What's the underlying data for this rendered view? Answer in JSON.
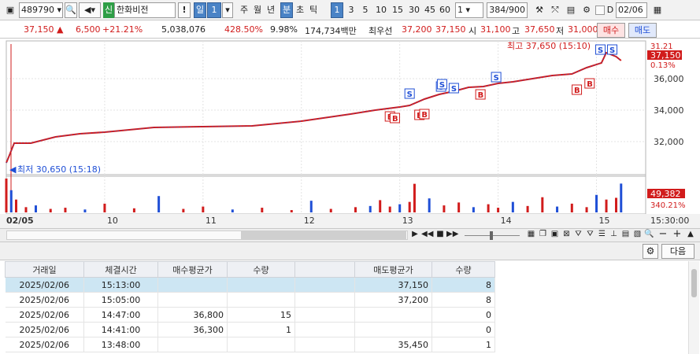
{
  "toolbar": {
    "code": "489790",
    "stock_name": "한화비전",
    "credit_badge": "신",
    "excl": "!",
    "period_day": "일",
    "period_num": "1",
    "periods": [
      "주",
      "월",
      "년"
    ],
    "period_min": "분",
    "period_sec": "초",
    "period_tick": "틱",
    "intervals": [
      "1",
      "3",
      "5",
      "10",
      "15",
      "30",
      "45",
      "60"
    ],
    "count_select": "1",
    "page_count": "384",
    "page_total": "/900",
    "date_prefix": "D",
    "date": "02/06"
  },
  "quote": {
    "price": "37,150",
    "arrow": "▲",
    "change": "6,500",
    "change_pct": "+21.21%",
    "volume": "5,038,076",
    "vol_ratio": "428.50%",
    "turnover": "9.98%",
    "amount": "174,734백만",
    "best_label": "최우선",
    "best_ask": "37,200",
    "best_bid": "37,150",
    "open_label": "시",
    "open": "31,100",
    "high_label": "고",
    "high": "37,650",
    "low_label": "저",
    "low": "31,000",
    "buy_label": "매수",
    "sell_label": "매도"
  },
  "chart_data": {
    "type": "line",
    "title": "",
    "xlabel": "",
    "ylabel": "",
    "price_ylim": [
      30000,
      38200
    ],
    "y_ticks": [
      "36,000",
      "34,000",
      "32,000"
    ],
    "y_tick_values": [
      36000,
      34000,
      32000
    ],
    "x_ticks": [
      "02/05",
      "10",
      "11",
      "12",
      "13",
      "14",
      "15",
      "15:30:00"
    ],
    "x_tick_values": [
      9.0,
      10.0,
      11.0,
      12.0,
      13.0,
      14.0,
      15.0,
      15.5
    ],
    "x_range": [
      9.0,
      15.5
    ],
    "price_series": {
      "name": "",
      "x": [
        9.0,
        9.03,
        9.08,
        9.25,
        9.5,
        9.75,
        10.0,
        10.5,
        11.0,
        11.5,
        12.0,
        12.5,
        12.75,
        13.0,
        13.1,
        13.25,
        13.4,
        13.55,
        13.7,
        13.85,
        14.0,
        14.15,
        14.35,
        14.55,
        14.75,
        14.9,
        15.05,
        15.1,
        15.2,
        15.25
      ],
      "values": [
        30650,
        31100,
        31900,
        31900,
        32300,
        32500,
        32600,
        32900,
        32950,
        33000,
        33300,
        33750,
        34000,
        34200,
        34300,
        34700,
        35000,
        35200,
        35450,
        35500,
        35700,
        35800,
        36000,
        36200,
        36300,
        36700,
        37000,
        37650,
        37400,
        37150
      ]
    },
    "high_annotation": "최고 37,650 (15:10)",
    "low_annotation": "최저 30,650 (15:18)",
    "last_price_label": "37,150",
    "last_price_pct": "0.13%",
    "last_price_fragment": "31.21",
    "volume_last_label": "49,382",
    "volume_pct_label": "340.21%",
    "volume_max": 62000,
    "volume_x": [
      9.0,
      9.05,
      9.1,
      9.2,
      9.3,
      9.45,
      9.6,
      9.8,
      10.0,
      10.3,
      10.55,
      10.8,
      11.0,
      11.3,
      11.6,
      11.9,
      12.1,
      12.3,
      12.55,
      12.7,
      12.8,
      12.9,
      13.0,
      13.1,
      13.15,
      13.3,
      13.45,
      13.6,
      13.75,
      13.9,
      14.0,
      14.15,
      14.3,
      14.45,
      14.6,
      14.75,
      14.9,
      15.0,
      15.1,
      15.2,
      15.25
    ],
    "volume_values": [
      58000,
      38000,
      22000,
      9000,
      12000,
      6000,
      8000,
      5000,
      15000,
      7000,
      28000,
      6000,
      10000,
      5000,
      8000,
      4000,
      20000,
      6000,
      9000,
      11000,
      21000,
      10000,
      14000,
      18000,
      49000,
      24000,
      12000,
      17000,
      9000,
      14000,
      8000,
      18000,
      11000,
      26000,
      10000,
      15000,
      9000,
      30000,
      22000,
      25000,
      49382
    ],
    "markers": [
      {
        "label": "B",
        "x": 12.9,
        "y": 34000
      },
      {
        "label": "B",
        "x": 12.95,
        "y": 33900
      },
      {
        "label": "B",
        "x": 13.2,
        "y": 34100
      },
      {
        "label": "B",
        "x": 13.25,
        "y": 34150
      },
      {
        "label": "S",
        "x": 13.1,
        "y": 34550
      },
      {
        "label": "S",
        "x": 13.42,
        "y": 35000
      },
      {
        "label": "S",
        "x": 13.43,
        "y": 35150
      },
      {
        "label": "S",
        "x": 13.55,
        "y": 34900
      },
      {
        "label": "B",
        "x": 13.82,
        "y": 35400
      },
      {
        "label": "S",
        "x": 13.98,
        "y": 35600
      },
      {
        "label": "B",
        "x": 14.8,
        "y": 35700
      },
      {
        "label": "B",
        "x": 14.93,
        "y": 36100
      },
      {
        "label": "S",
        "x": 15.04,
        "y": 37350
      },
      {
        "label": "S",
        "x": 15.16,
        "y": 37350
      }
    ],
    "grid": true,
    "legend": "none"
  },
  "lower": {
    "next_label": "다음",
    "columns": [
      "거래일",
      "체결시간",
      "매수평균가",
      "수량",
      "",
      "매도평균가",
      "수량"
    ],
    "rows": [
      [
        "2025/02/06",
        "15:13:00",
        "",
        "",
        "",
        "37,150",
        "8"
      ],
      [
        "2025/02/06",
        "15:05:00",
        "",
        "",
        "",
        "37,200",
        "8"
      ],
      [
        "2025/02/06",
        "14:47:00",
        "36,800",
        "15",
        "",
        "",
        "0"
      ],
      [
        "2025/02/06",
        "14:41:00",
        "36,300",
        "1",
        "",
        "",
        "0"
      ],
      [
        "2025/02/06",
        "13:48:00",
        "",
        "",
        "",
        "35,450",
        "1"
      ]
    ]
  },
  "colors": {
    "up": "#d11c1c",
    "down": "#1f4fd6",
    "accent": "#4a83c6",
    "highlight_row": "#cde6f3"
  }
}
